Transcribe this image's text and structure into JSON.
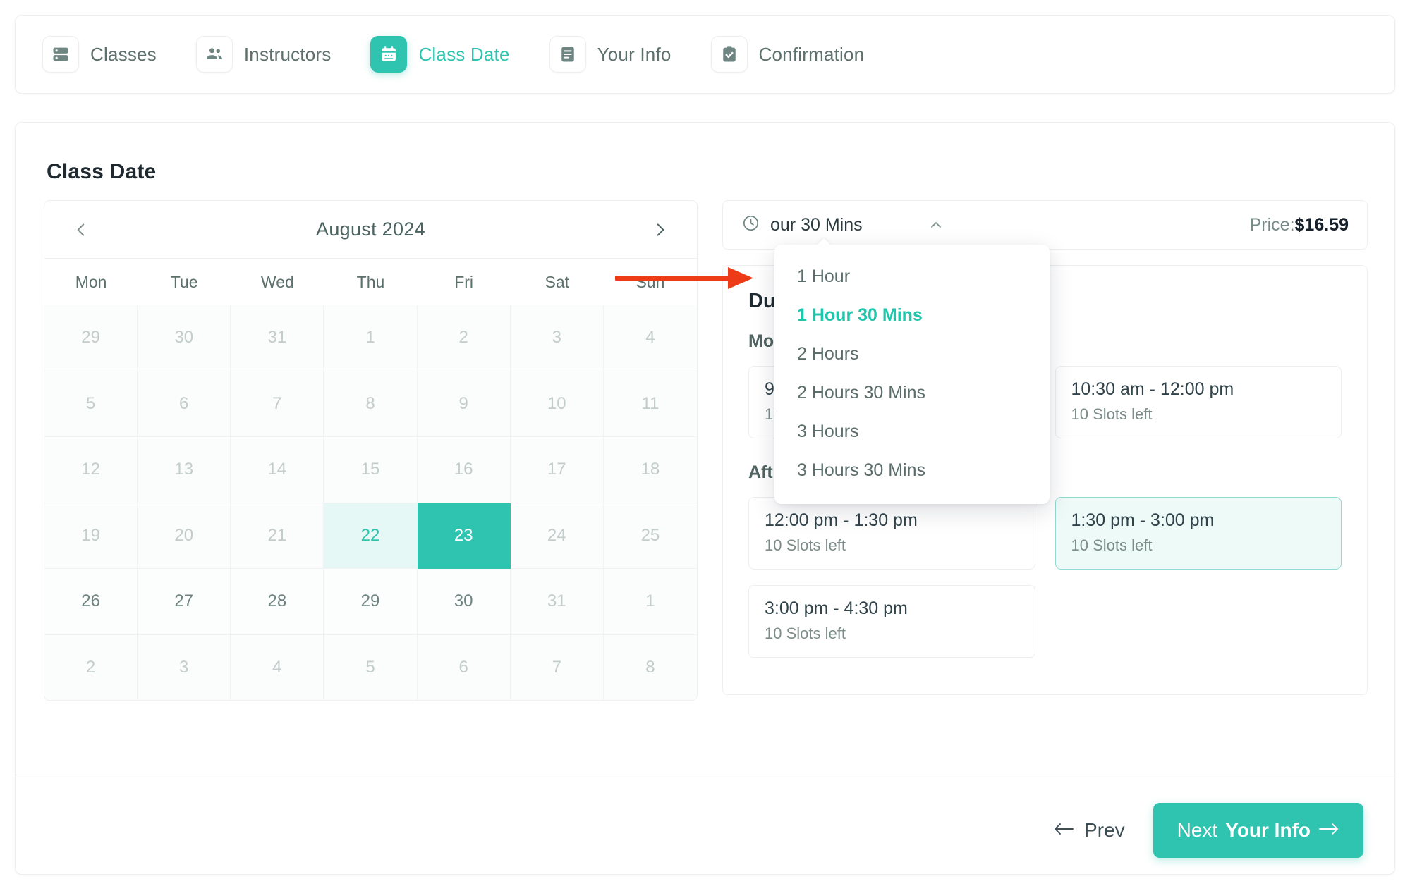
{
  "stepper": {
    "steps": [
      {
        "label": "Classes",
        "icon": "server-rows-icon",
        "active": false
      },
      {
        "label": "Instructors",
        "icon": "people-icon",
        "active": false
      },
      {
        "label": "Class Date",
        "icon": "calendar-icon",
        "active": true
      },
      {
        "label": "Your Info",
        "icon": "form-lines-icon",
        "active": false
      },
      {
        "label": "Confirmation",
        "icon": "clipboard-check-icon",
        "active": false
      }
    ]
  },
  "main": {
    "title": "Class Date"
  },
  "calendar": {
    "month_label": "August 2024",
    "prev_icon": "chevron-left-icon",
    "next_icon": "chevron-right-icon",
    "weekdays": [
      "Mon",
      "Tue",
      "Wed",
      "Thu",
      "Fri",
      "Sat",
      "Sun"
    ],
    "days": [
      {
        "d": "29",
        "state": "muted"
      },
      {
        "d": "30",
        "state": "muted"
      },
      {
        "d": "31",
        "state": "muted"
      },
      {
        "d": "1",
        "state": "muted"
      },
      {
        "d": "2",
        "state": "muted"
      },
      {
        "d": "3",
        "state": "muted"
      },
      {
        "d": "4",
        "state": "muted"
      },
      {
        "d": "5",
        "state": "muted"
      },
      {
        "d": "6",
        "state": "muted"
      },
      {
        "d": "7",
        "state": "muted"
      },
      {
        "d": "8",
        "state": "muted"
      },
      {
        "d": "9",
        "state": "muted"
      },
      {
        "d": "10",
        "state": "muted"
      },
      {
        "d": "11",
        "state": "muted"
      },
      {
        "d": "12",
        "state": "muted"
      },
      {
        "d": "13",
        "state": "muted"
      },
      {
        "d": "14",
        "state": "muted"
      },
      {
        "d": "15",
        "state": "muted"
      },
      {
        "d": "16",
        "state": "muted"
      },
      {
        "d": "17",
        "state": "muted"
      },
      {
        "d": "18",
        "state": "muted"
      },
      {
        "d": "19",
        "state": "muted"
      },
      {
        "d": "20",
        "state": "muted"
      },
      {
        "d": "21",
        "state": "muted"
      },
      {
        "d": "22",
        "state": "today"
      },
      {
        "d": "23",
        "state": "selected"
      },
      {
        "d": "24",
        "state": "muted"
      },
      {
        "d": "25",
        "state": "muted"
      },
      {
        "d": "26",
        "state": "normal"
      },
      {
        "d": "27",
        "state": "normal"
      },
      {
        "d": "28",
        "state": "normal"
      },
      {
        "d": "29",
        "state": "normal"
      },
      {
        "d": "30",
        "state": "normal"
      },
      {
        "d": "31",
        "state": "muted"
      },
      {
        "d": "1",
        "state": "muted"
      },
      {
        "d": "2",
        "state": "muted"
      },
      {
        "d": "3",
        "state": "muted"
      },
      {
        "d": "4",
        "state": "muted"
      },
      {
        "d": "5",
        "state": "muted"
      },
      {
        "d": "6",
        "state": "muted"
      },
      {
        "d": "7",
        "state": "muted"
      },
      {
        "d": "8",
        "state": "muted"
      }
    ]
  },
  "duration": {
    "clock_icon": "clock-icon",
    "selected_value": "our 30 Mins",
    "caret_icon": "chevron-up-icon",
    "price_label": "Price:",
    "price_value": "$16.59",
    "options": [
      {
        "label": "1 Hour",
        "selected": false
      },
      {
        "label": "1 Hour 30 Mins",
        "selected": true
      },
      {
        "label": "2 Hours",
        "selected": false
      },
      {
        "label": "2 Hours 30 Mins",
        "selected": false
      },
      {
        "label": "3 Hours",
        "selected": false
      },
      {
        "label": "3 Hours 30 Mins",
        "selected": false
      }
    ]
  },
  "slots": {
    "panel_title": "Du",
    "morning_title": "Mo",
    "afternoon_title": "Aft",
    "morning": [
      {
        "time": "9:0",
        "left": "10",
        "selected": false
      },
      {
        "time": "10:30 am - 12:00 pm",
        "left": "10 Slots left",
        "selected": false
      }
    ],
    "afternoon": [
      {
        "time": "12:00 pm - 1:30 pm",
        "left": "10 Slots left",
        "selected": false
      },
      {
        "time": "1:30 pm - 3:00 pm",
        "left": "10 Slots left",
        "selected": true
      },
      {
        "time": "3:00 pm - 4:30 pm",
        "left": "10 Slots left",
        "selected": false
      }
    ]
  },
  "annotation": {
    "arrow_color": "#ee3b17",
    "arrow_icon": "red-arrow-right-annotation"
  },
  "footer": {
    "prev_label": "Prev",
    "prev_icon": "arrow-left-icon",
    "next_label_plain": "Next ",
    "next_label_bold": "Your Info",
    "next_icon": "arrow-right-icon"
  }
}
